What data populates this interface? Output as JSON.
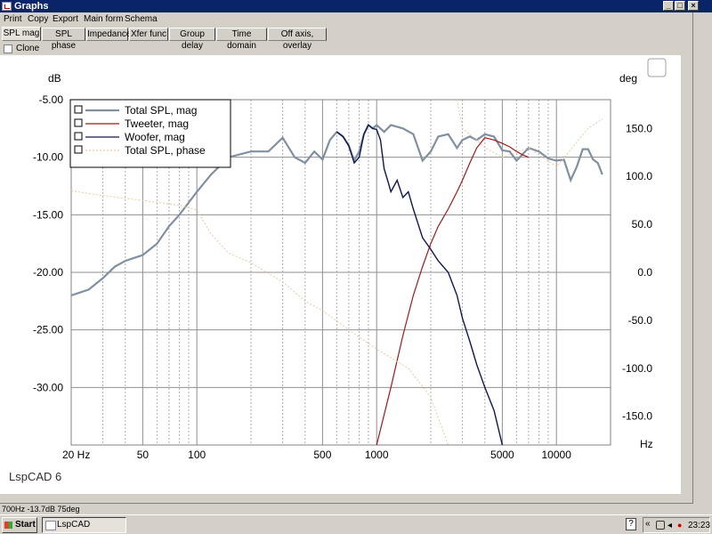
{
  "window": {
    "title": "Graphs"
  },
  "menu": [
    "Print",
    "Copy",
    "Export",
    "Main form",
    "Schema"
  ],
  "tabs": [
    "SPL mag",
    "SPL phase",
    "Impedance",
    "Xfer func",
    "Group delay",
    "Time domain",
    "Off axis, overlay"
  ],
  "active_tab": "SPL mag",
  "clone_label": "Clone",
  "status": "700Hz -13.7dB  75deg",
  "taskbar": {
    "start": "Start",
    "app": "LspCAD",
    "help": "?",
    "tray_arrows": "«",
    "clock": "23:23"
  },
  "chart_data": {
    "type": "line",
    "watermark": "LspCAD 6",
    "left_axis": {
      "label": "dB",
      "ticks": [
        "-5.00",
        "-10.00",
        "-15.00",
        "-20.00",
        "-25.00",
        "-30.00"
      ],
      "range": [
        -35,
        -5
      ]
    },
    "right_axis": {
      "label": "deg",
      "ticks": [
        "150.0",
        "100.0",
        "50.0",
        "0.0",
        "-50.0",
        "-100.0",
        "-150.0"
      ],
      "range": [
        -180,
        180
      ]
    },
    "x_axis": {
      "label": "Hz",
      "scale": "log",
      "range": [
        20,
        20000
      ],
      "ticks": [
        "20 Hz",
        "50",
        "100",
        "500",
        "1000",
        "5000",
        "10000"
      ]
    },
    "legend": [
      "Total SPL, mag",
      "Tweeter, mag",
      "Woofer, mag",
      "Total SPL, phase"
    ],
    "colors": {
      "total": "#8090a0",
      "tweeter": "#a01818",
      "woofer": "#101850",
      "phase": "#f0c8a0"
    },
    "series": [
      {
        "name": "Total SPL, mag",
        "axis": "left",
        "x": [
          20,
          25,
          30,
          35,
          40,
          50,
          60,
          70,
          80,
          100,
          120,
          150,
          200,
          250,
          300,
          350,
          400,
          450,
          500,
          550,
          600,
          650,
          700,
          750,
          800,
          850,
          900,
          950,
          1000,
          1100,
          1200,
          1400,
          1600,
          1800,
          2000,
          2200,
          2500,
          2800,
          3000,
          3300,
          3600,
          4000,
          4500,
          5000,
          5500,
          6000,
          7000,
          8000,
          9000,
          10000,
          11000,
          12000,
          13000,
          14000,
          15000,
          16000,
          17000,
          18000
        ],
        "y": [
          -22,
          -21.5,
          -20.5,
          -19.5,
          -19,
          -18.5,
          -17.5,
          -16,
          -15,
          -13,
          -11.5,
          -10,
          -9.5,
          -9.5,
          -8.3,
          -10,
          -10.5,
          -9.5,
          -10.2,
          -8.5,
          -7.8,
          -8.2,
          -9,
          -10.3,
          -9.5,
          -8,
          -7.2,
          -7.5,
          -7.2,
          -7.8,
          -7.2,
          -7.5,
          -8,
          -10.3,
          -9.5,
          -8.2,
          -8,
          -9.2,
          -8.5,
          -8.2,
          -8.5,
          -8,
          -8.2,
          -9.4,
          -9.5,
          -10.3,
          -9.2,
          -9.5,
          -10.1,
          -10.3,
          -10.2,
          -12,
          -10.8,
          -9.3,
          -9.3,
          -10.2,
          -10.5,
          -11.5
        ]
      },
      {
        "name": "Tweeter, mag",
        "axis": "left",
        "x": [
          1000,
          1200,
          1400,
          1600,
          1800,
          2000,
          2200,
          2500,
          2800,
          3000,
          3300,
          3600,
          4000,
          4500,
          5000,
          5500,
          6000,
          6500,
          7000
        ],
        "y": [
          -35,
          -30,
          -25.5,
          -22,
          -19.5,
          -17.5,
          -16,
          -14.5,
          -13,
          -12,
          -10.5,
          -9.2,
          -8.3,
          -8.5,
          -8.8,
          -9.1,
          -9.5,
          -9.8,
          -10
        ]
      },
      {
        "name": "Woofer, mag",
        "axis": "left",
        "x": [
          600,
          650,
          700,
          750,
          800,
          850,
          900,
          950,
          1000,
          1050,
          1100,
          1150,
          1200,
          1300,
          1400,
          1500,
          1600,
          1800,
          2000,
          2200,
          2500,
          2800,
          3000,
          3300,
          3600,
          4000,
          4500,
          5000
        ],
        "y": [
          -7.8,
          -8.2,
          -9,
          -10.5,
          -10,
          -8,
          -7.2,
          -7.5,
          -7.6,
          -8.5,
          -11,
          -12,
          -13,
          -12,
          -13.5,
          -13,
          -14.5,
          -17,
          -18,
          -19,
          -20,
          -22,
          -24,
          -26,
          -28,
          -30,
          -32,
          -35
        ]
      },
      {
        "name": "Total SPL, phase",
        "axis": "right",
        "x": [
          20,
          30,
          50,
          80,
          100,
          120,
          150,
          200,
          300,
          400,
          500,
          700,
          1000,
          1500,
          2000,
          2500,
          2800,
          3000,
          3500,
          4000,
          5000,
          7000,
          10000,
          15000,
          18000
        ],
        "y": [
          85,
          80,
          75,
          70,
          65,
          40,
          20,
          10,
          -10,
          -30,
          -40,
          -60,
          -80,
          -100,
          -130,
          -180,
          180,
          150,
          140,
          130,
          120,
          130,
          110,
          150,
          160
        ]
      }
    ]
  }
}
